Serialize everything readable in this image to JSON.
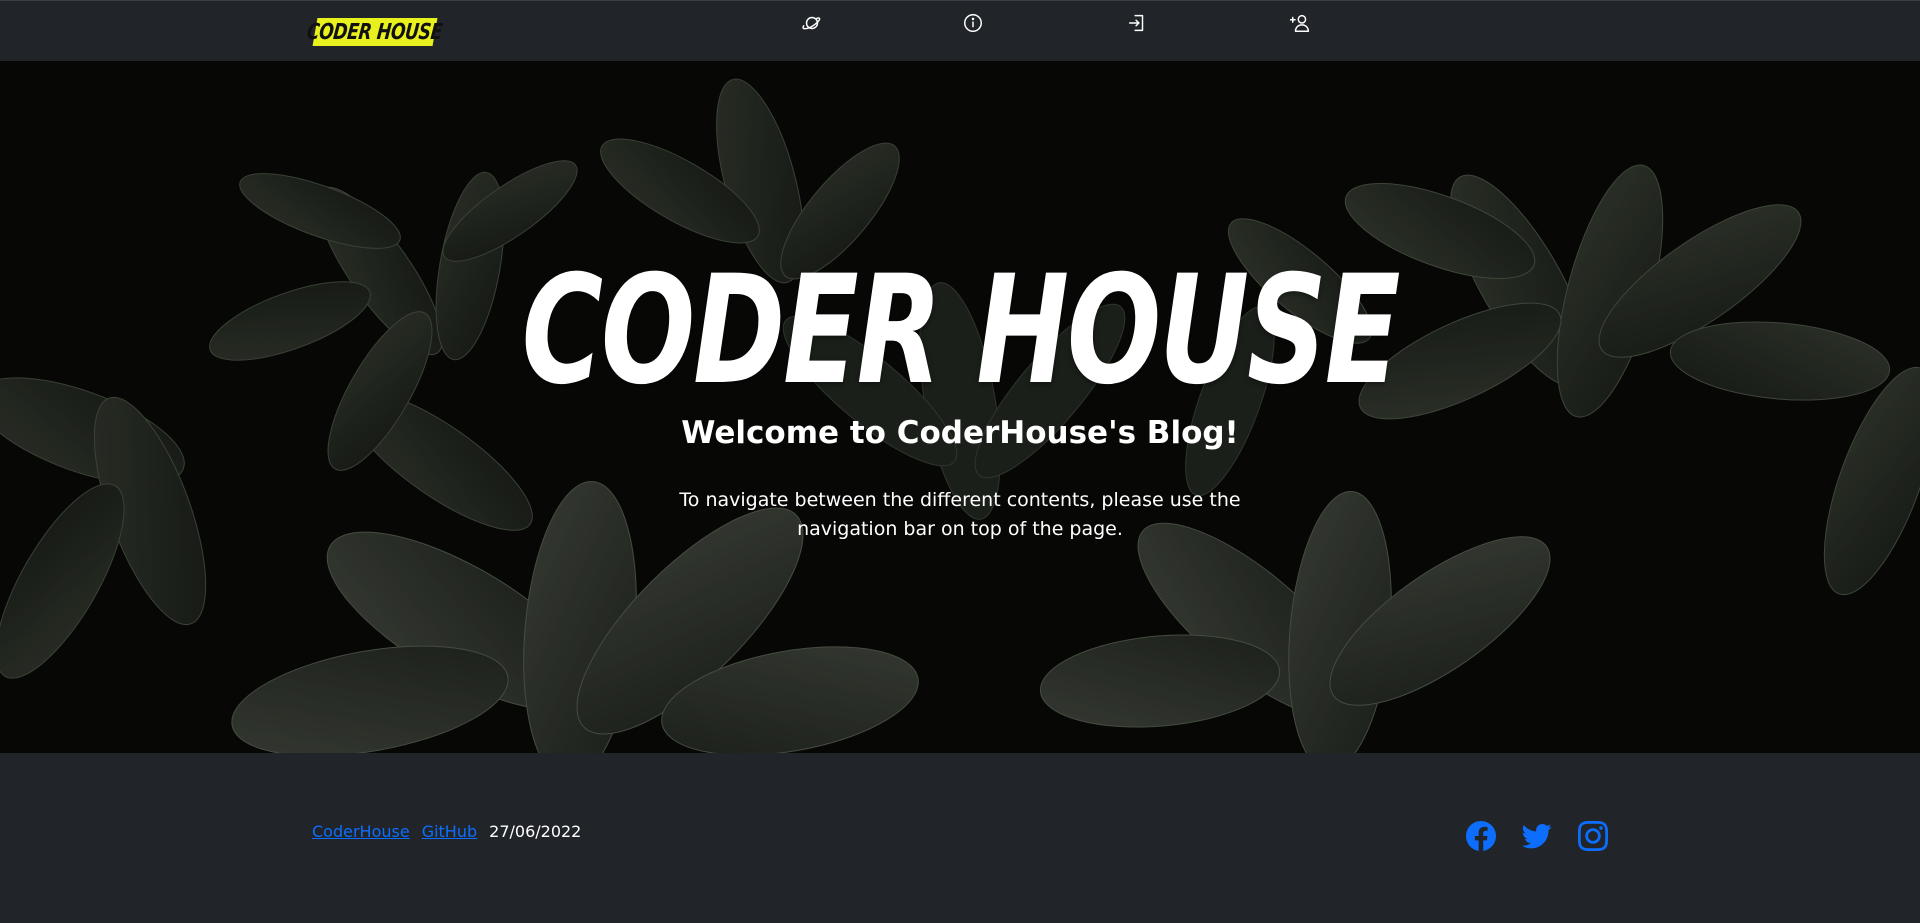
{
  "navbar": {
    "logo_text": "CODER HOUSE",
    "logo_color": "#e8f01e",
    "icons": [
      {
        "name": "planet-icon",
        "label": "Home"
      },
      {
        "name": "info-icon",
        "label": "About"
      },
      {
        "name": "login-icon",
        "label": "Login"
      },
      {
        "name": "add-user-icon",
        "label": "Register"
      }
    ]
  },
  "hero": {
    "title": "CODER HOUSE",
    "subtitle": "Welcome to CoderHouse's Blog!",
    "description": "To navigate between the different contents, please use the navigation bar on top of the page."
  },
  "footer": {
    "link_coderhouse": "CoderHouse",
    "link_github": "GitHub",
    "date": "27/06/2022",
    "social_icons": [
      "facebook-icon",
      "twitter-icon",
      "instagram-icon"
    ],
    "accent_color": "#0d6efd"
  }
}
